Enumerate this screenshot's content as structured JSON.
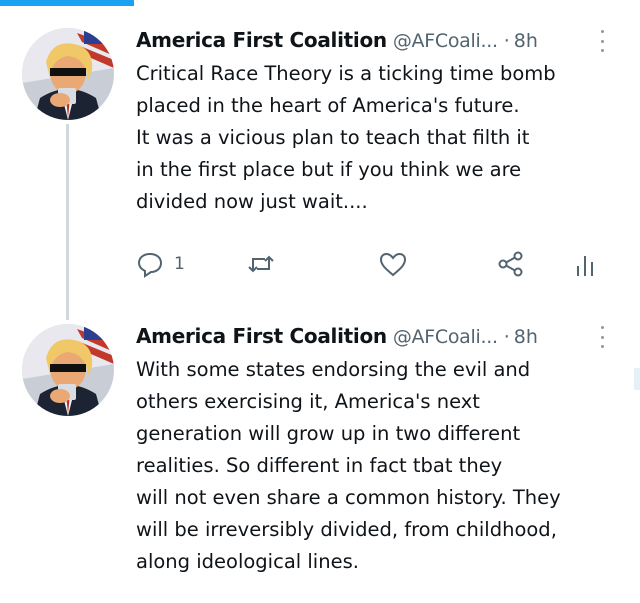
{
  "progress": {
    "value_percent": 21,
    "color": "#1da1f2"
  },
  "colors": {
    "text": "#0f1419",
    "secondary": "#536471",
    "thread_line": "#cfd9de"
  },
  "tweets": [
    {
      "author_name": "America First Coalition",
      "handle": "@AFCoali...",
      "separator": "·",
      "time": "8h",
      "text_lines": [
        "Critical Race Theory is a ticking time bomb",
        "placed in the heart of America's future.",
        "It was a vicious plan to teach that filth it",
        "in the first place but if you think we are",
        "divided now just wait...."
      ],
      "actions": {
        "reply_count": "1"
      }
    },
    {
      "author_name": "America First Coalition",
      "handle": "@AFCoali...",
      "separator": "·",
      "time": "8h",
      "text_lines": [
        "With some states endorsing the evil and",
        "others exercising it, America's next",
        "generation will grow up in two different",
        "realities. So different in fact tbat they",
        "will not even share a common history. They",
        "will be irreversibly divided, from childhood,",
        "along ideological lines."
      ]
    }
  ],
  "icons": [
    "reply-icon",
    "retweet-icon",
    "like-icon",
    "share-icon",
    "analytics-icon",
    "more-options-icon"
  ]
}
